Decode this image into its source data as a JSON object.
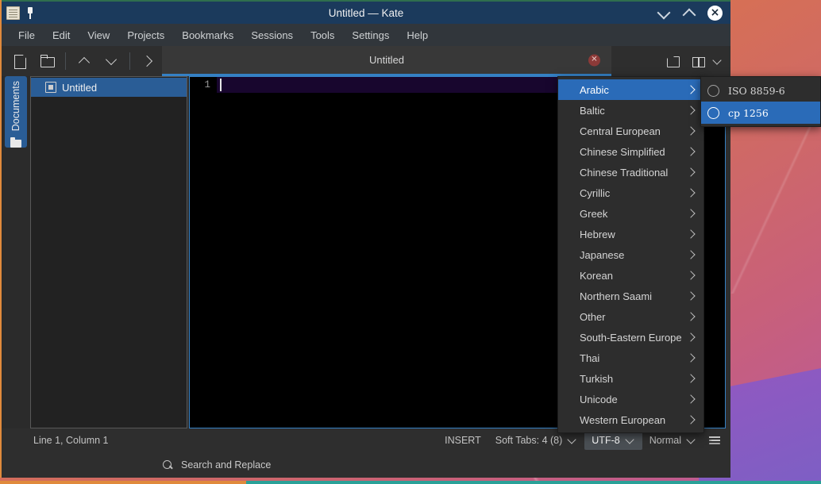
{
  "window": {
    "title": "Untitled  — Kate",
    "app_icon": "document-icon",
    "pin_icon": "pin-icon",
    "controls": {
      "minimize": "chevron-down-icon",
      "maximize": "chevron-up-icon",
      "close": "×"
    }
  },
  "menubar": {
    "items": [
      {
        "label": "File"
      },
      {
        "label": "Edit"
      },
      {
        "label": "View"
      },
      {
        "label": "Projects"
      },
      {
        "label": "Bookmarks"
      },
      {
        "label": "Sessions"
      },
      {
        "label": "Tools"
      },
      {
        "label": "Settings"
      },
      {
        "label": "Help"
      }
    ]
  },
  "toolbar": {
    "buttons": [
      {
        "name": "new-document",
        "icon": "new-document-icon"
      },
      {
        "name": "open-document",
        "icon": "open-folder-icon"
      },
      {
        "name": "previous-document",
        "icon": "chevron-up-icon"
      },
      {
        "name": "next-document",
        "icon": "chevron-down-icon"
      },
      {
        "name": "toolbar-overflow",
        "icon": "chevron-right-icon"
      }
    ]
  },
  "tabbar": {
    "tabs": [
      {
        "label": "Untitled",
        "close_glyph": "✕",
        "active": true
      }
    ],
    "right_buttons": [
      {
        "name": "detach-view",
        "icon": "detach-icon"
      },
      {
        "name": "split-view",
        "icon": "split-view-icon"
      },
      {
        "name": "split-view-menu",
        "icon": "chevron-down-icon"
      }
    ]
  },
  "sidebar": {
    "vertical_tab": {
      "label": "Documents",
      "icon": "folder-icon"
    },
    "documents": [
      {
        "label": "Untitled",
        "selected": true
      }
    ]
  },
  "editor": {
    "line_numbers": [
      "1"
    ],
    "content": ""
  },
  "statusbar": {
    "cursor_position": "Line 1, Column 1",
    "insert_mode": "INSERT",
    "tabs_setting": "Soft Tabs: 4 (8)",
    "encoding": "UTF-8",
    "mode": "Normal",
    "align_icon": "text-align-icon"
  },
  "searchbar": {
    "icon": "search-icon",
    "label": "Search and Replace"
  },
  "encoding_menu": {
    "items": [
      {
        "label": "Arabic",
        "highlighted": true
      },
      {
        "label": "Baltic",
        "highlighted": false
      },
      {
        "label": "Central European",
        "highlighted": false
      },
      {
        "label": "Chinese Simplified",
        "highlighted": false
      },
      {
        "label": "Chinese Traditional",
        "highlighted": false
      },
      {
        "label": "Cyrillic",
        "highlighted": false
      },
      {
        "label": "Greek",
        "highlighted": false
      },
      {
        "label": "Hebrew",
        "highlighted": false
      },
      {
        "label": "Japanese",
        "highlighted": false
      },
      {
        "label": "Korean",
        "highlighted": false
      },
      {
        "label": "Northern Saami",
        "highlighted": false
      },
      {
        "label": "Other",
        "highlighted": false
      },
      {
        "label": "South-Eastern Europe",
        "highlighted": false
      },
      {
        "label": "Thai",
        "highlighted": false
      },
      {
        "label": "Turkish",
        "highlighted": false
      },
      {
        "label": "Unicode",
        "highlighted": false
      },
      {
        "label": "Western European",
        "highlighted": false
      }
    ]
  },
  "charset_submenu": {
    "items": [
      {
        "label": "ISO 8859-6",
        "selected": false,
        "highlighted": false
      },
      {
        "label": "cp 1256",
        "selected": false,
        "highlighted": true
      }
    ]
  },
  "colors": {
    "titlebar": "#1b3a5c",
    "accent": "#2a6bb8",
    "menu_bg": "#2d2d2d",
    "window_bg": "#2e2e2e",
    "editor_bg": "#000000",
    "current_line": "#18062e"
  }
}
